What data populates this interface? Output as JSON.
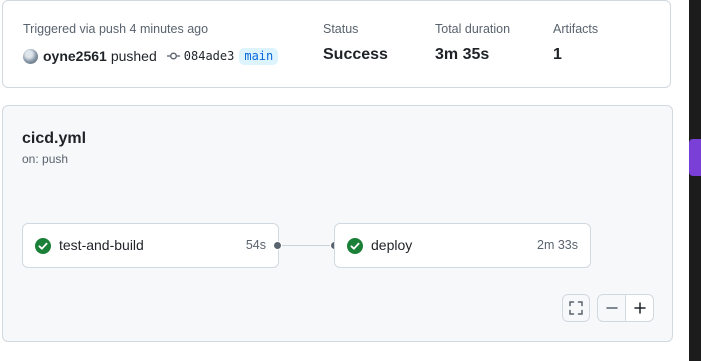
{
  "summary": {
    "trigger_text": "Triggered via push 4 minutes ago",
    "user": "oyne2561",
    "action": "pushed",
    "commit_sha": "084ade3",
    "branch": "main",
    "status_label": "Status",
    "status_value": "Success",
    "duration_label": "Total duration",
    "duration_value": "3m 35s",
    "artifacts_label": "Artifacts",
    "artifacts_value": "1"
  },
  "workflow": {
    "file": "cicd.yml",
    "trigger": "on: push",
    "jobs": [
      {
        "name": "test-and-build",
        "duration": "54s",
        "status": "success"
      },
      {
        "name": "deploy",
        "duration": "2m 33s",
        "status": "success"
      }
    ]
  },
  "controls": {
    "fullscreen_icon": "fullscreen-icon",
    "zoom_out_icon": "minus-icon",
    "zoom_in_icon": "plus-icon"
  },
  "colors": {
    "success": "#1a7f37",
    "accent": "#0969da",
    "border": "#d1d9e0",
    "panel_bg": "#f6f8fa"
  }
}
